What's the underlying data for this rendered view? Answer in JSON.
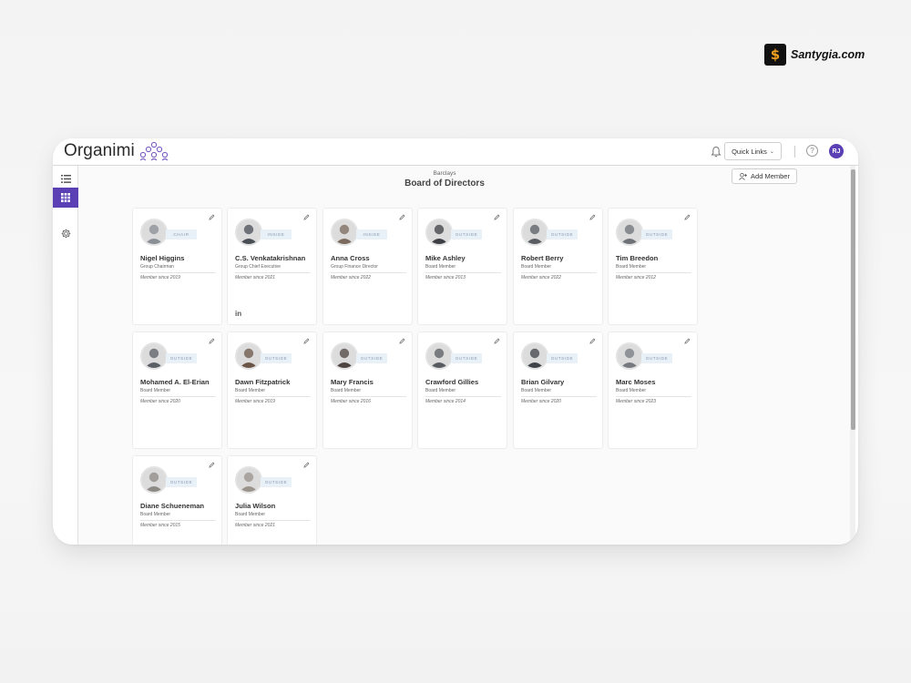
{
  "watermark": {
    "text": "Santygia.com"
  },
  "app": {
    "brand": "Organimi"
  },
  "topbar": {
    "quick_links_label": "Quick Links",
    "help_label": "?",
    "user_initials": "RJ"
  },
  "leftnav": {
    "items": [
      {
        "icon": "list-icon",
        "active": false
      },
      {
        "icon": "grid-icon",
        "active": true
      },
      {
        "icon": "gear-icon",
        "active": false
      }
    ]
  },
  "header": {
    "organization": "Barclays",
    "title": "Board of Directors",
    "add_member_label": "Add Member"
  },
  "colors": {
    "accent": "#5b3fb5",
    "badge_bg": "#e8f0f8",
    "badge_text": "#8a9ab0"
  },
  "members": [
    {
      "name": "Nigel Higgins",
      "role": "Group Chairman",
      "badge": "CHAIR",
      "since": "Member since 2019",
      "linkedin": ""
    },
    {
      "name": "C.S. Venkatakrishnan",
      "role": "Group Chief Executive",
      "badge": "INSIDE",
      "since": "Member since 2021",
      "linkedin": "in"
    },
    {
      "name": "Anna Cross",
      "role": "Group Finance Director",
      "badge": "INSIDE",
      "since": "Member since 2022",
      "linkedin": ""
    },
    {
      "name": "Mike Ashley",
      "role": "Board Member",
      "badge": "OUTSIDE",
      "since": "Member since 2013",
      "linkedin": ""
    },
    {
      "name": "Robert Berry",
      "role": "Board Member",
      "badge": "OUTSIDE",
      "since": "Member since 2022",
      "linkedin": ""
    },
    {
      "name": "Tim Breedon",
      "role": "Board Member",
      "badge": "OUTSIDE",
      "since": "Member since 2012",
      "linkedin": ""
    },
    {
      "name": "Mohamed A. El-Erian",
      "role": "Board Member",
      "badge": "OUTSIDE",
      "since": "Member since 2020",
      "linkedin": ""
    },
    {
      "name": "Dawn Fitzpatrick",
      "role": "Board Member",
      "badge": "OUTSIDE",
      "since": "Member since 2019",
      "linkedin": ""
    },
    {
      "name": "Mary Francis",
      "role": "Board Member",
      "badge": "OUTSIDE",
      "since": "Member since 2016",
      "linkedin": ""
    },
    {
      "name": "Crawford Gillies",
      "role": "Board Member",
      "badge": "OUTSIDE",
      "since": "Member since 2014",
      "linkedin": ""
    },
    {
      "name": "Brian Gilvary",
      "role": "Board Member",
      "badge": "OUTSIDE",
      "since": "Member since 2020",
      "linkedin": ""
    },
    {
      "name": "Marc Moses",
      "role": "Board Member",
      "badge": "OUTSIDE",
      "since": "Member since 2023",
      "linkedin": ""
    },
    {
      "name": "Diane Schueneman",
      "role": "Board Member",
      "badge": "OUTSIDE",
      "since": "Member since 2015",
      "linkedin": ""
    },
    {
      "name": "Julia Wilson",
      "role": "Board Member",
      "badge": "OUTSIDE",
      "since": "Member since 2021",
      "linkedin": ""
    }
  ]
}
